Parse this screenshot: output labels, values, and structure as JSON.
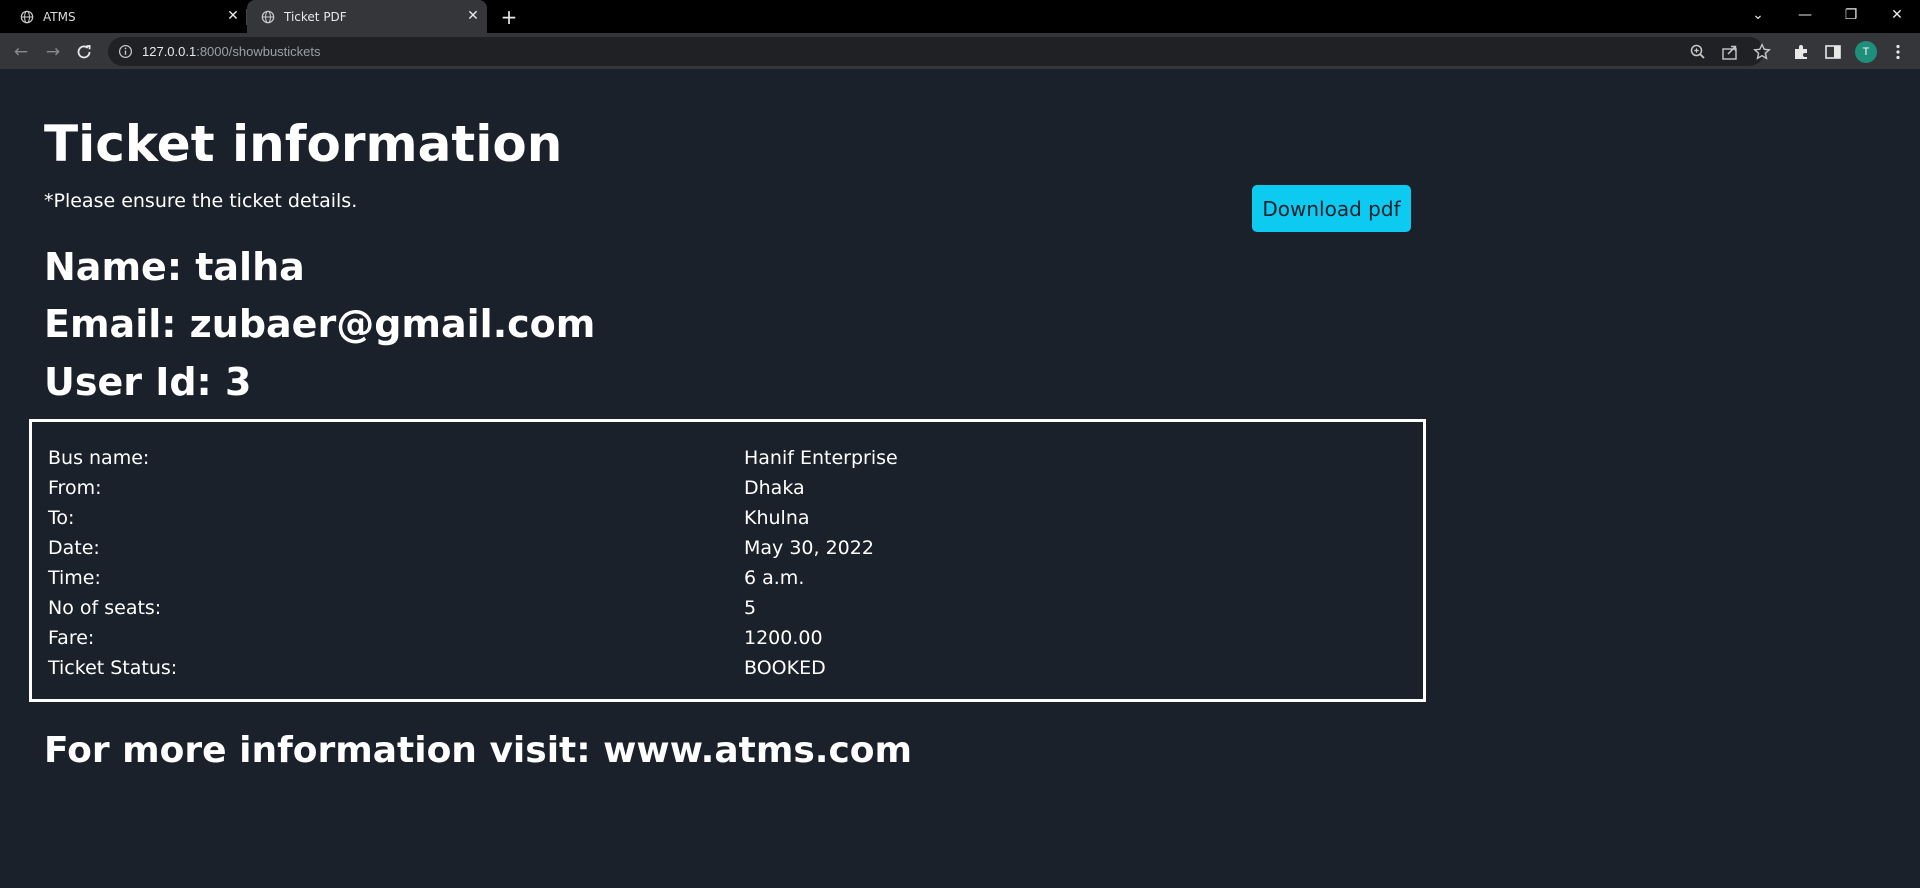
{
  "browser": {
    "tabs": [
      {
        "title": "ATMS",
        "active": false
      },
      {
        "title": "Ticket PDF",
        "active": true
      }
    ],
    "address": {
      "host": "127.0.0.1",
      "path": ":8000/showbustickets"
    },
    "profile_initial": "T",
    "accent_color": "#0dcaf0"
  },
  "page": {
    "title": "Ticket information",
    "subtitle": "*Please ensure the ticket details.",
    "download_button": "Download pdf",
    "name_line": "Name: talha",
    "email_line": "Email: zubaer@gmail.com",
    "userid_line": "User Id: 3",
    "ticket": [
      {
        "label": "Bus name:",
        "value": "Hanif Enterprise"
      },
      {
        "label": "From:",
        "value": "Dhaka"
      },
      {
        "label": "To:",
        "value": "Khulna"
      },
      {
        "label": "Date:",
        "value": "May 30, 2022"
      },
      {
        "label": "Time:",
        "value": "6 a.m."
      },
      {
        "label": "No of seats:",
        "value": "5"
      },
      {
        "label": "Fare:",
        "value": "1200.00"
      },
      {
        "label": "Ticket Status:",
        "value": "BOOKED"
      }
    ],
    "footer": "For more information visit: www.atms.com"
  }
}
